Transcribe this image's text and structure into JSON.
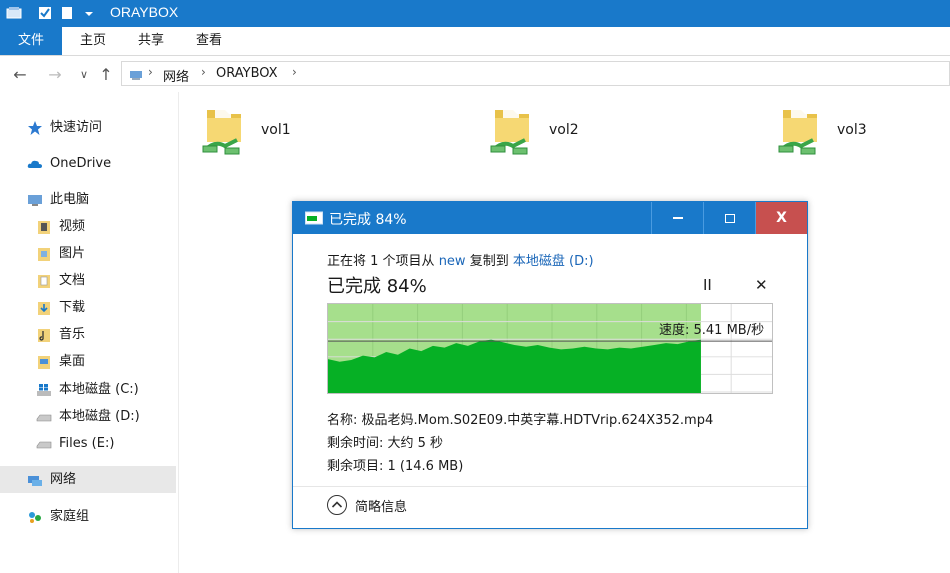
{
  "window": {
    "title": "ORAYBOX"
  },
  "ribbon": {
    "tabs": [
      "文件",
      "主页",
      "共享",
      "查看"
    ]
  },
  "address": {
    "segments": [
      "网络",
      "ORAYBOX"
    ]
  },
  "sidebar": {
    "items": [
      {
        "label": "快速访问",
        "icon": "star-icon"
      },
      {
        "label": "OneDrive",
        "icon": "cloud-icon"
      },
      {
        "label": "此电脑",
        "icon": "computer-icon"
      },
      {
        "label": "视频",
        "icon": "video-folder-icon"
      },
      {
        "label": "图片",
        "icon": "pictures-folder-icon"
      },
      {
        "label": "文档",
        "icon": "documents-folder-icon"
      },
      {
        "label": "下载",
        "icon": "downloads-folder-icon"
      },
      {
        "label": "音乐",
        "icon": "music-folder-icon"
      },
      {
        "label": "桌面",
        "icon": "desktop-folder-icon"
      },
      {
        "label": "本地磁盘 (C:)",
        "icon": "windows-drive-icon"
      },
      {
        "label": "本地磁盘 (D:)",
        "icon": "drive-icon"
      },
      {
        "label": "Files (E:)",
        "icon": "drive-icon"
      },
      {
        "label": "网络",
        "icon": "network-icon"
      },
      {
        "label": "家庭组",
        "icon": "homegroup-icon"
      }
    ],
    "selected": "网络"
  },
  "folders": [
    {
      "label": "vol1"
    },
    {
      "label": "vol2"
    },
    {
      "label": "vol3"
    }
  ],
  "dialog": {
    "title": "已完成 84%",
    "line_prefix": "正在将 1 个项目从",
    "source": "new",
    "line_middle": "复制到",
    "destination": "本地磁盘 (D:)",
    "big_status": "已完成 84%",
    "progress": 0.84,
    "speed_label": "速度: 5.41 MB/秒",
    "name_label": "名称: 极品老妈.Mom.S02E09.中英字幕.HDTVrip.624X352.mp4",
    "time_label": "剩余时间: 大约 5 秒",
    "items_label": "剩余项目: 1 (14.6 MB)",
    "details_toggle": "简略信息",
    "pause_glyph": "II",
    "cancel_glyph": "✕"
  },
  "colors": {
    "accent": "#1979ca",
    "close": "#c7504f",
    "progress_light": "#a6df8c",
    "progress_dark": "#06b025"
  }
}
